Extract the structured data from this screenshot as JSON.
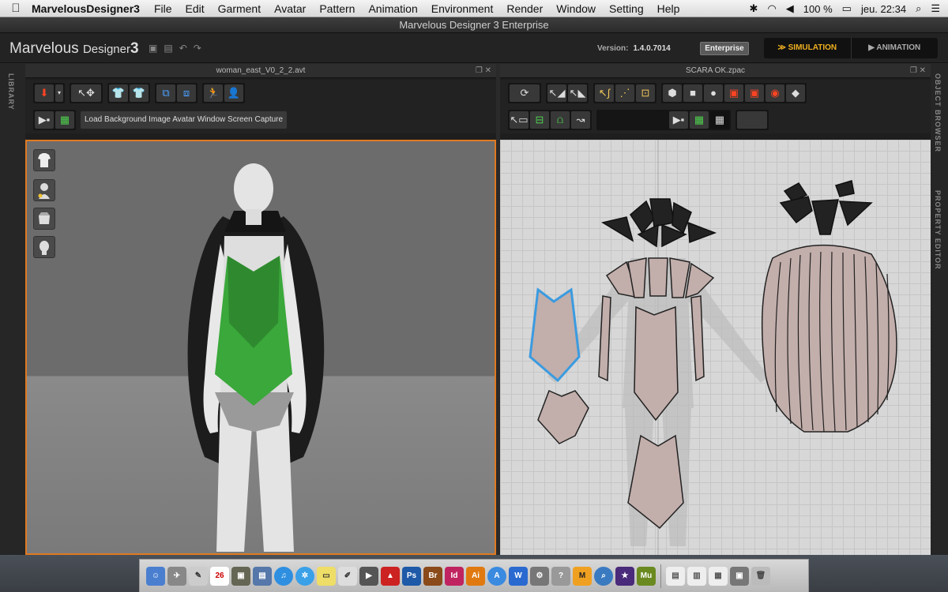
{
  "menubar": {
    "apple": "",
    "app_name": "MarvelousDesigner3",
    "items": [
      "File",
      "Edit",
      "Garment",
      "Avatar",
      "Pattern",
      "Animation",
      "Environment",
      "Render",
      "Window",
      "Setting",
      "Help"
    ],
    "battery": "100 %",
    "clock": "jeu. 22:34"
  },
  "window": {
    "title": "Marvelous Designer 3 Enterprise"
  },
  "header": {
    "logo_main": "Marvelous",
    "logo_sub": "Designer",
    "logo_num": "3",
    "version_label": "Version:",
    "version_value": "1.4.0.7014",
    "edition": "Enterprise",
    "mode_simulation": "SIMULATION",
    "mode_animation": "ANIMATION"
  },
  "sidebars": {
    "left_label": "LIBRARY",
    "right_label_1": "OBJECT BROWSER",
    "right_label_2": "PROPERTY EDITOR"
  },
  "panel_3d": {
    "title": "woman_east_V0_2_2.avt",
    "toolbar2_text": "Load Background Image Avatar Window Screen Capture"
  },
  "panel_2d": {
    "title": "SCARA OK.zpac"
  },
  "colors": {
    "accent_orange": "#e07a20",
    "simulation_gold": "#f0b020",
    "garment_green": "#3aa83a",
    "pattern_fill": "#c2aeab",
    "selected_pattern": "#3b9be0"
  },
  "dock": {
    "calendar_day": "26"
  }
}
